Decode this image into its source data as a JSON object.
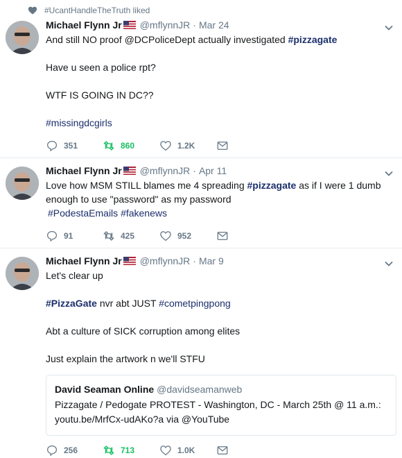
{
  "context": {
    "label": "#UcantHandleTheTruth liked"
  },
  "colors": {
    "hashtag": "#1b2f6b",
    "muted": "#657786",
    "retweet_green": "#17bf63"
  },
  "tweets": [
    {
      "name": "Michael Flynn Jr",
      "handle": "@mflynnJR",
      "dot": "·",
      "time": "Mar 24",
      "lines": {
        "l1a": "And still NO proof @DCPoliceDept actually investigated ",
        "l1b": "#pizzagate",
        "l2": "Have u seen a police rpt?",
        "l3": "WTF IS GOING IN DC??",
        "l4": "#missingdcgirls"
      },
      "replies": "351",
      "retweets": "860",
      "likes": "1.2K"
    },
    {
      "name": "Michael Flynn Jr",
      "handle": "@mflynnJR",
      "dot": "·",
      "time": "Apr 11",
      "lines": {
        "l1a": "Love how MSM STILL blames me 4 spreading ",
        "l1b": "#pizzagate",
        "l1c": " as if I were 1 dumb",
        "l2": "enough to use \"password\" as my password",
        "l3a": "#PodestaEmails",
        "l3b": "#fakenews"
      },
      "replies": "91",
      "retweets": "425",
      "likes": "952"
    },
    {
      "name": "Michael Flynn Jr",
      "handle": "@mflynnJR",
      "dot": "·",
      "time": "Mar 9",
      "lines": {
        "l1": "Let's clear up",
        "l2a": "#PizzaGate",
        "l2b": " nvr abt JUST ",
        "l2c": "#cometpingpong",
        "l3": "Abt a culture of SICK corruption among elites",
        "l4": "Just explain the artwork n we'll STFU"
      },
      "quote": {
        "name": "David Seaman Online",
        "handle": "@davidseamanweb",
        "line1": "Pizzagate / Pedogate PROTEST - Washington, DC - March 25th @ 11 a.m.:",
        "line2": "youtu.be/MrfCx-udAKo?a via @YouTube"
      },
      "replies": "256",
      "retweets": "713",
      "likes": "1.0K"
    }
  ]
}
